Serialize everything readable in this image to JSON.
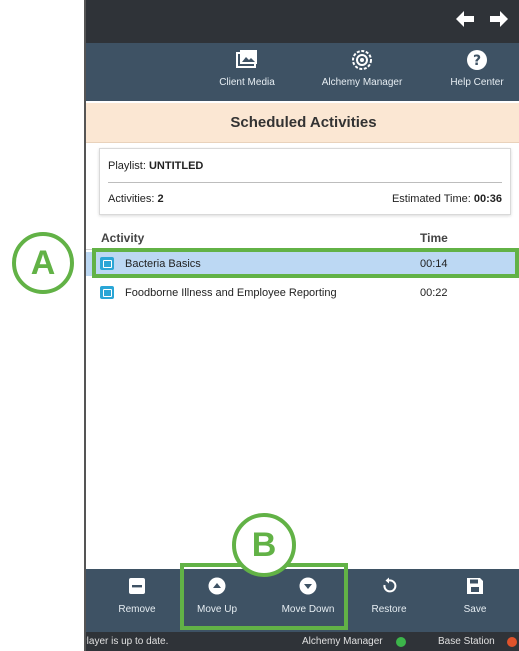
{
  "nav": {
    "back_icon": "arrow-left-icon",
    "forward_icon": "arrow-right-icon"
  },
  "menu": {
    "client_media": {
      "label": "Client Media",
      "icon": "image-icon"
    },
    "alchemy_manager": {
      "label": "Alchemy Manager",
      "icon": "gear-icon"
    },
    "help_center": {
      "label": "Help Center",
      "icon": "question-icon"
    }
  },
  "page": {
    "title": "Scheduled Activities"
  },
  "summary": {
    "playlist_label": "Playlist: ",
    "playlist_name": "UNTITLED",
    "activities_label": "Activities: ",
    "activities_count": "2",
    "estimated_label": "Estimated Time: ",
    "estimated_time": "00:36"
  },
  "table": {
    "columns": [
      "Activity",
      "Time"
    ],
    "rows": [
      {
        "name": "Bacteria Basics",
        "time": "00:14",
        "selected": true
      },
      {
        "name": "Foodborne Illness and Employee Reporting",
        "time": "00:22",
        "selected": false
      }
    ]
  },
  "toolbar": {
    "remove": {
      "label": "Remove",
      "icon": "minus-square-icon"
    },
    "move_up": {
      "label": "Move Up",
      "icon": "arrow-up-circle-icon"
    },
    "move_down": {
      "label": "Move Down",
      "icon": "arrow-down-circle-icon"
    },
    "restore": {
      "label": "Restore",
      "icon": "undo-icon"
    },
    "save": {
      "label": "Save",
      "icon": "save-icon"
    }
  },
  "status": {
    "message": "Player is up to date.",
    "manager": "Alchemy Manager",
    "base": "Base Station"
  },
  "annotations": {
    "a": "A",
    "b": "B",
    "color": "#62b246"
  },
  "colors": {
    "header": "#2f3338",
    "menubar": "#3e5264",
    "title_bg": "#fbe7d3",
    "selected_row": "#bcd8f3",
    "activity_icon": "#2aa6d6"
  }
}
